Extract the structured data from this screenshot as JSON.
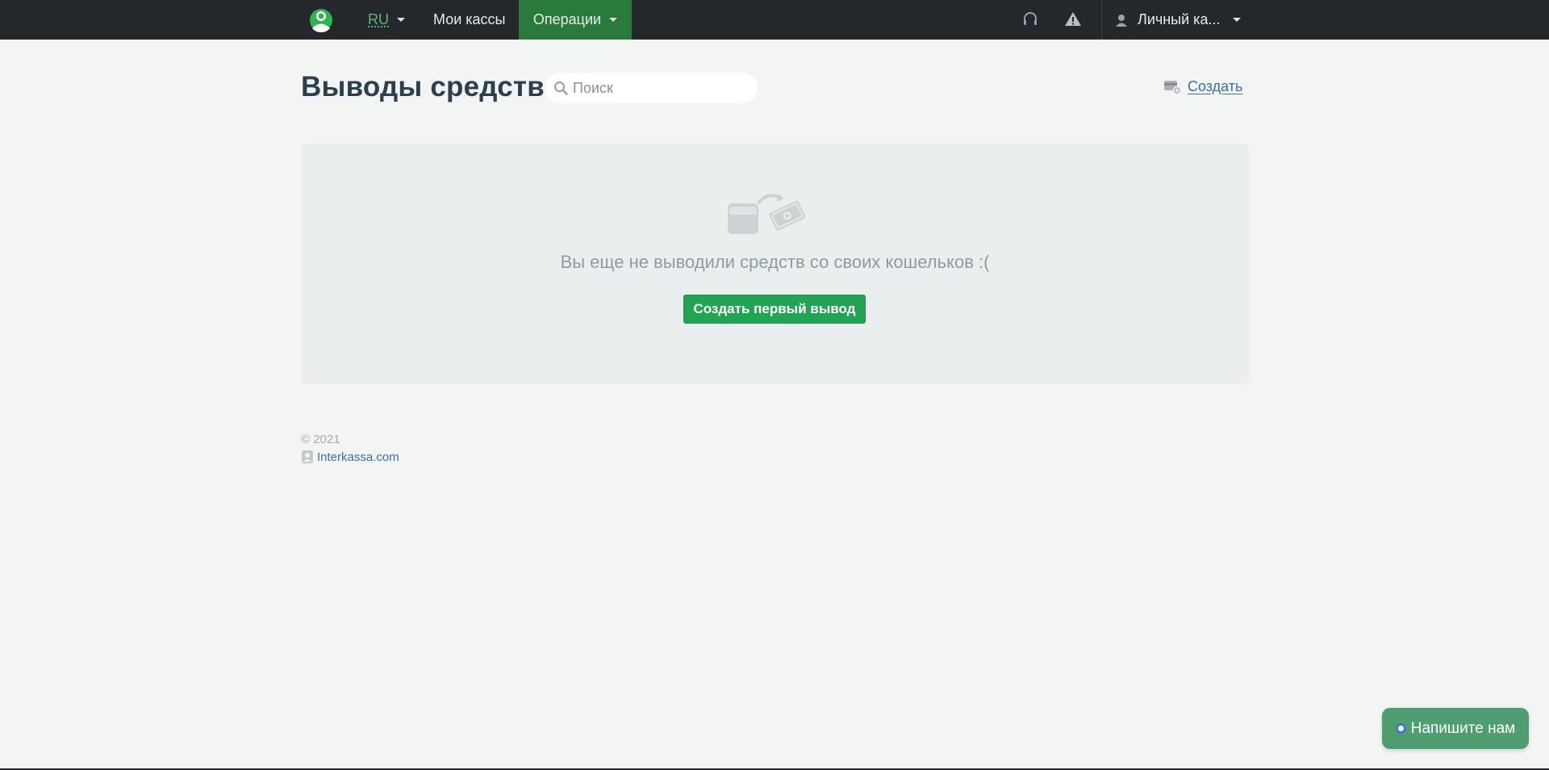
{
  "navbar": {
    "language": "RU",
    "cashboxes": "Мои кассы",
    "operations": "Операции",
    "account": "Личный ка..."
  },
  "header": {
    "title": "Выводы средств",
    "search_placeholder": "Поиск",
    "create_label": "Создать"
  },
  "empty_state": {
    "message": "Вы еще не выводили средств со своих кошельков :(",
    "button_label": "Создать первый вывод"
  },
  "footer": {
    "copyright": "© 2021",
    "site_link": "Interkassa.com"
  },
  "chat": {
    "label": "Напишите нам"
  },
  "colors": {
    "navbar_bg": "#24272b",
    "active_tab": "#2b7a3d",
    "accent_green": "#23a455",
    "link_blue": "#3c6f9c",
    "chat_bg": "#4f9d70"
  },
  "icons": [
    "interkassa-logo-icon",
    "headset-icon",
    "alert-icon",
    "user-icon",
    "search-icon",
    "create-card-icon",
    "wallet-money-icon",
    "chevron-down-icon"
  ]
}
